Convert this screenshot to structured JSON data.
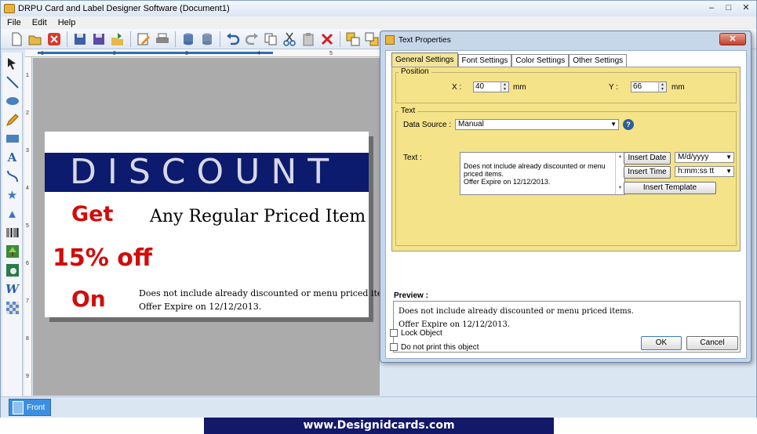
{
  "app": {
    "title": "DRPU Card and Label Designer Software  (Document1)",
    "window_buttons": [
      "–",
      "□",
      "✕"
    ]
  },
  "menu": [
    "File",
    "Edit",
    "Help"
  ],
  "ruler": {
    "top_ticks": [
      "1",
      "2",
      "3",
      "4",
      "5"
    ],
    "left_ticks": [
      "1",
      "2",
      "3",
      "4",
      "5",
      "6",
      "7",
      "8",
      "9"
    ]
  },
  "card": {
    "banner_text": "DISCOUNT",
    "get": "Get",
    "item": "Any Regular Priced Item",
    "percent": "15% off",
    "on": "On",
    "line1": "Does not include already discounted or menu priced items.",
    "line2": "Offer Expire on 12/12/2013.",
    "banner_color": "#0c1b6e",
    "accent_color": "#d20b0b"
  },
  "statusbar": {
    "tab_label": "Front"
  },
  "footer": {
    "url": "www.Designidcards.com"
  },
  "dialog": {
    "title": "Text Properties",
    "close": "✕",
    "tabs": [
      "General Settings",
      "Font Settings",
      "Color Settings",
      "Other Settings"
    ],
    "active_tab": "General Settings",
    "position": {
      "group_label": "Position",
      "x_label": "X :",
      "x_value": "40",
      "x_unit": "mm",
      "y_label": "Y :",
      "y_value": "66",
      "y_unit": "mm"
    },
    "text_group": {
      "group_label": "Text",
      "data_source_label": "Data Source :",
      "data_source_value": "Manual",
      "help": "?",
      "text_label": "Text :",
      "text_value": "Does not include already discounted or menu priced items.\nOffer Expire on 12/12/2013.",
      "insert_date": "Insert Date",
      "date_format": "M/d/yyyy",
      "insert_time": "Insert Time",
      "time_format": "h:mm:ss tt",
      "insert_template": "Insert Template"
    },
    "preview": {
      "label": "Preview :",
      "text": "Does not include already discounted or menu priced items.\nOffer Expire on 12/12/2013."
    },
    "lock_object": "Lock Object",
    "no_print": "Do not print this object",
    "ok": "OK",
    "cancel": "Cancel"
  }
}
